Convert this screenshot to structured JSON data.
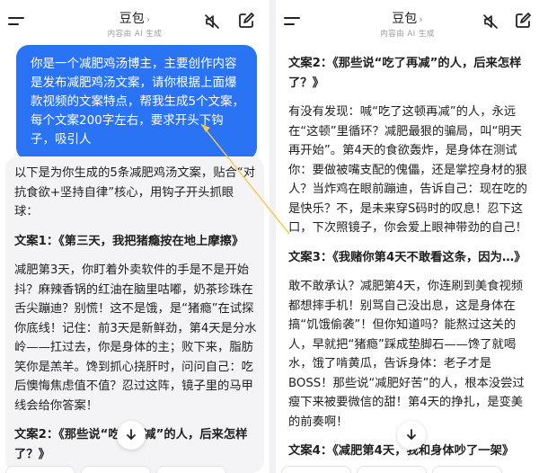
{
  "app": {
    "title": "豆包",
    "title_chevron": "›",
    "subtitle": "内容由 AI 生成"
  },
  "icons": {
    "menu": "menu-icon",
    "mute": "speaker-muted-icon",
    "edit": "new-chat-edit-icon",
    "scroll_down": "arrow-down-icon"
  },
  "colors": {
    "user_bubble": "#2a73f5",
    "reply_card": "#f4f4f6",
    "pointer_line": "#f2c94c"
  },
  "left": {
    "user_message": "你是一个减肥鸡汤博主，主要创作内容是发布减肥鸡汤文案，请你根据上面爆款视频的文案特点，帮我生成5个文案，每个文案200字左右，要求开头下钩子，吸引人",
    "reply": {
      "intro": "以下是为你生成的5条减肥鸡汤文案，贴合“对抗食欲+坚持自律”核心，用钩子开头抓眼球：",
      "copy1_heading": "文案1：《第三天，我把猪瘾按在地上摩擦》",
      "copy1_body": "减肥第3天，你盯着外卖软件的手是不是开始抖？麻辣香锅的红油在脑里咕嘟，奶茶珍珠在舌尖蹦迪？别慌！这不是饿，是“猪瘾”在试探你底线！记住：前3天是新鲜劲，第4天是分水岭——扛过去，你是身体的主；败下来，脂肪笑你是羔羊。馋到抓心挠肝时，问问自己：吃后懊悔焦虑值不值？忍过这阵，镜子里的马甲线会给你答案！",
      "copy2_heading": "文案2：《那些说“吃了再减”的人，后来怎样了？》"
    }
  },
  "right": {
    "copy2_heading": "文案2：《那些说“吃了再减”的人，后来怎样了？》",
    "copy2_body": "有没有发现：喊“吃了这顿再减”的人，永远在“这顿”里循环？减肥最狠的骗局，叫“明天再开始”。第4天的食欲轰炸，是身体在测试你：要做被嘴支配的傀儡，还是掌控身材的狠人？当炸鸡在眼前蹦迪，告诉自己：现在吃的是快乐？不，是未来穿S码时的叹息！忍下这口，下次照镜子，你会爱上眼神带劲的自己！",
    "copy3_heading": "文案3：《我赌你第4天不敢看这条，因为…》",
    "copy3_body": "敢不敢承认？减肥第4天，你连刷到美食视频都想摔手机！别骂自己没出息，这是身体在搞“饥饿偷袭”！但你知道吗？能熬过这关的人，早就把“猪瘾”踩成垫脚石——馋了就喝水，饿了啃黄瓜，告诉身体：老子才是BOSS！那些说“减肥好苦”的人，根本没尝过瘦下来被要微信的甜！第4天的挣扎，是变美的前奏啊！",
    "copy4_heading": "文案4：《减肥第4天，我和身体吵了一架》"
  }
}
